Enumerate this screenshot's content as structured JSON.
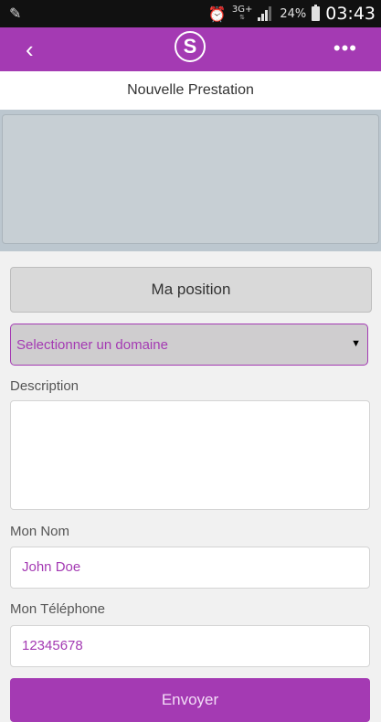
{
  "status_bar": {
    "network": "3G+",
    "battery": "24%",
    "time": "03:43"
  },
  "app_bar": {
    "logo": "S",
    "back_icon": "chevron-left-icon",
    "menu_icon": "more-horizontal-icon"
  },
  "page": {
    "title": "Nouvelle Prestation"
  },
  "form": {
    "position_button": "Ma position",
    "domain_select": {
      "value": "Selectionner un domaine"
    },
    "description_label": "Description",
    "description_value": "",
    "name_label": "Mon Nom",
    "name_value": "John Doe",
    "phone_label": "Mon Téléphone",
    "phone_value": "12345678",
    "submit_button": "Envoyer"
  },
  "colors": {
    "accent": "#a43ab3",
    "status_bar": "#111111",
    "background": "#f1f1f1"
  }
}
